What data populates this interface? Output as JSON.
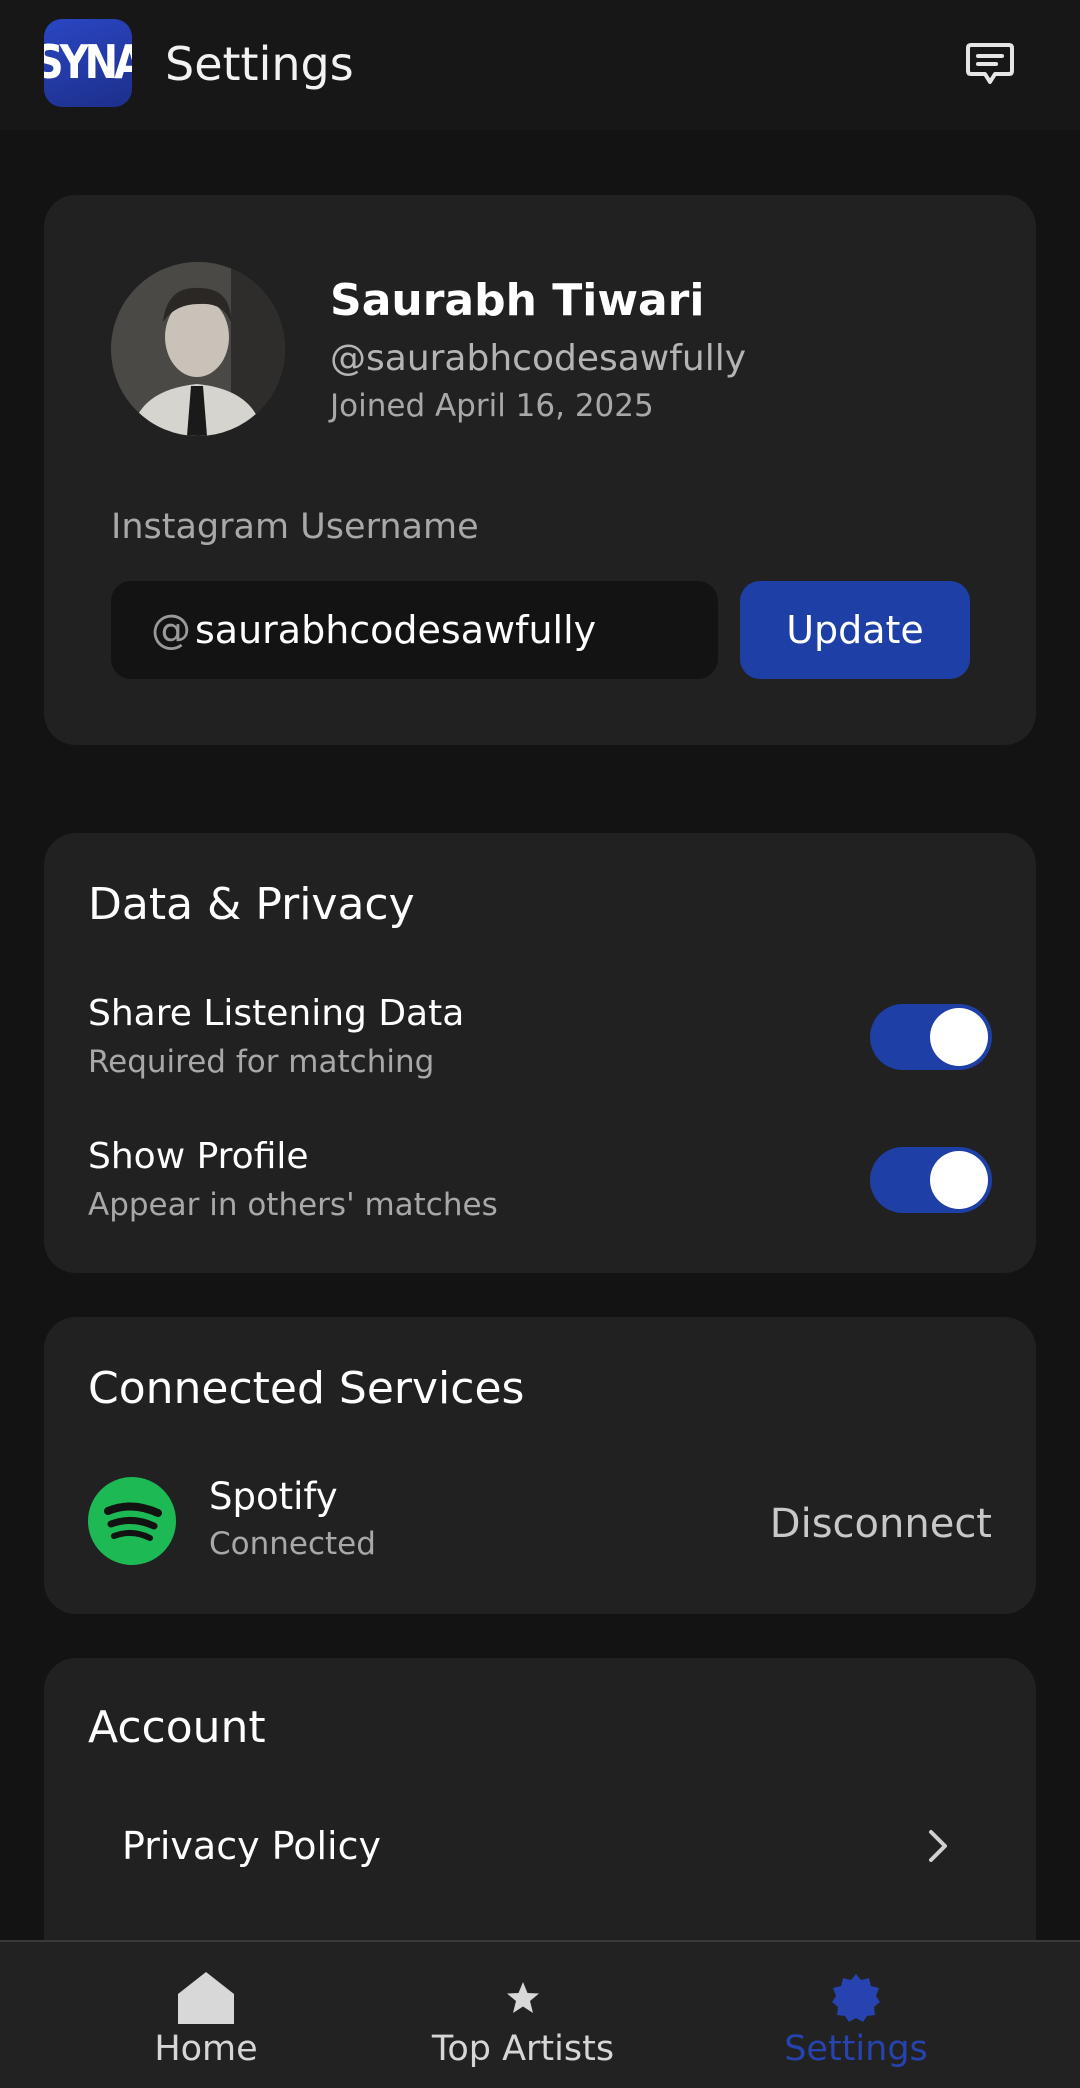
{
  "header": {
    "logo_text": "SYNA",
    "title": "Settings",
    "icon": "chat-icon"
  },
  "profile": {
    "name": "Saurabh Tiwari",
    "handle": "@saurabhcodesawfully",
    "joined": "Joined April 16, 2025",
    "instagram": {
      "label": "Instagram Username",
      "prefix": "@",
      "value": "saurabhcodesawfully",
      "button_label": "Update"
    }
  },
  "privacy": {
    "title": "Data & Privacy",
    "items": [
      {
        "label": "Share Listening Data",
        "sublabel": "Required for matching",
        "enabled": true
      },
      {
        "label": "Show Profile",
        "sublabel": "Appear in others' matches",
        "enabled": true
      }
    ]
  },
  "services": {
    "title": "Connected Services",
    "items": [
      {
        "name": "Spotify",
        "status": "Connected",
        "action_label": "Disconnect",
        "icon": "spotify-icon"
      }
    ]
  },
  "account": {
    "title": "Account",
    "items": [
      {
        "label": "Privacy Policy",
        "icon": "chevron-right-icon"
      }
    ]
  },
  "nav": {
    "items": [
      {
        "label": "Home",
        "icon": "home-icon",
        "active": false
      },
      {
        "label": "Top Artists",
        "icon": "star-icon",
        "active": false
      },
      {
        "label": "Settings",
        "icon": "settings-gear-icon",
        "active": true
      }
    ]
  },
  "colors": {
    "background": "#131313",
    "card": "#212121",
    "accent": "#1e3fa6",
    "spotify_green": "#1db954",
    "active_nav": "#2643b0"
  }
}
